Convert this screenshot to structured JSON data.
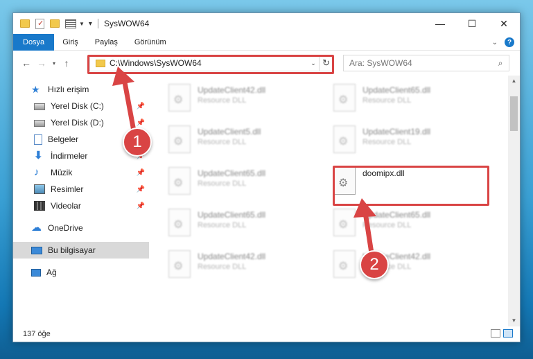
{
  "window": {
    "title": "SysWOW64"
  },
  "ribbon": {
    "tabs": [
      "Dosya",
      "Giriş",
      "Paylaş",
      "Görünüm"
    ]
  },
  "address": {
    "path": "C:\\Windows\\SysWOW64"
  },
  "search": {
    "placeholder": "Ara: SysWOW64"
  },
  "sidebar": {
    "items": [
      {
        "label": "Hızlı erişim",
        "icon": "star-icon"
      },
      {
        "label": "Yerel Disk (C:)",
        "icon": "disk-icon",
        "pinned": true
      },
      {
        "label": "Yerel Disk (D:)",
        "icon": "disk-icon",
        "pinned": true
      },
      {
        "label": "Belgeler",
        "icon": "documents-icon",
        "pinned": true
      },
      {
        "label": "İndirmeler",
        "icon": "downloads-icon",
        "pinned": true
      },
      {
        "label": "Müzik",
        "icon": "music-icon",
        "pinned": true
      },
      {
        "label": "Resimler",
        "icon": "pictures-icon",
        "pinned": true
      },
      {
        "label": "Videolar",
        "icon": "videos-icon",
        "pinned": true
      },
      {
        "label": "OneDrive",
        "icon": "cloud-icon"
      },
      {
        "label": "Bu bilgisayar",
        "icon": "computer-icon",
        "selected": true
      },
      {
        "label": "Ağ",
        "icon": "network-icon"
      }
    ]
  },
  "files": [
    {
      "name": "UpdateClient42.dll",
      "type": "Resource DLL"
    },
    {
      "name": "UpdateClient65.dll",
      "type": "Resource DLL"
    },
    {
      "name": "UpdateClient5.dll",
      "type": "Resource DLL"
    },
    {
      "name": "UpdateClient19.dll",
      "type": "Resource DLL"
    },
    {
      "name": "UpdateClient65.dll",
      "type": "Resource DLL"
    },
    {
      "name": "doomipx.dll",
      "type": ""
    },
    {
      "name": "UpdateClient65.dll",
      "type": "Resource DLL"
    },
    {
      "name": "UpdateClient65.dll",
      "type": "Resource DLL"
    },
    {
      "name": "UpdateClient42.dll",
      "type": "Resource DLL"
    },
    {
      "name": "UpdateClient42.dll",
      "type": "Resource DLL"
    }
  ],
  "status": {
    "count": "137 öğe"
  },
  "annotations": {
    "step1": "1",
    "step2": "2",
    "color": "#d94444"
  }
}
